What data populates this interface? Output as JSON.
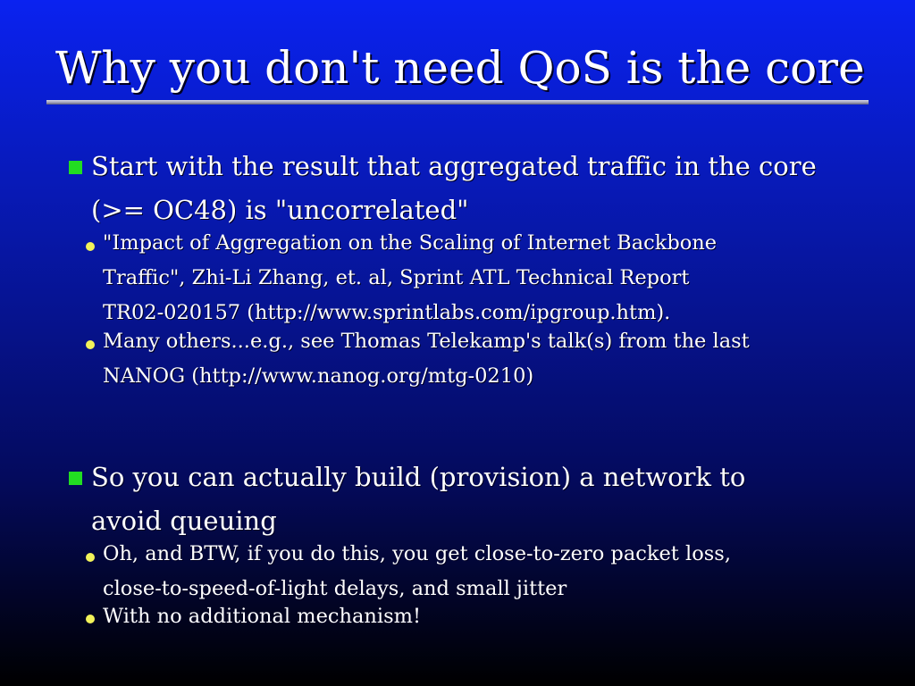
{
  "slide": {
    "title": "Why you don't need QoS is the core",
    "bullets": [
      {
        "lines": [
          "Start with the result that aggregated traffic in the core",
          "(>= OC48) is \"uncorrelated\""
        ],
        "subbullets": [
          {
            "lines": [
              "\"Impact of Aggregation on the Scaling of Internet Backbone",
              "Traffic\", Zhi-Li Zhang, et. al, Sprint ATL Technical Report",
              "TR02-020157 (http://www.sprintlabs.com/ipgroup.htm)."
            ]
          },
          {
            "lines": [
              "Many others...e.g., see Thomas Telekamp's talk(s) from the last",
              "NANOG (http://www.nanog.org/mtg-0210)"
            ]
          }
        ]
      },
      {
        "lines": [
          "So you can actually build (provision) a network to",
          "avoid queuing"
        ],
        "subbullets": [
          {
            "lines": [
              "Oh, and BTW, if you do this, you get close-to-zero packet loss,",
              "close-to-speed-of-light delays, and small jitter"
            ]
          },
          {
            "lines": [
              "With no additional mechanism!"
            ]
          }
        ]
      }
    ]
  },
  "colors": {
    "background_top": "#0a22f0",
    "background_bottom": "#000000",
    "text": "#ffffff",
    "level1_bullet": "#22dd22",
    "level2_bullet": "#f2f25a",
    "rule": "#b0b0c8"
  },
  "icons": {
    "level1_bullet": "green-square-bullet-icon",
    "level2_bullet": "yellow-dot-bullet-icon"
  }
}
